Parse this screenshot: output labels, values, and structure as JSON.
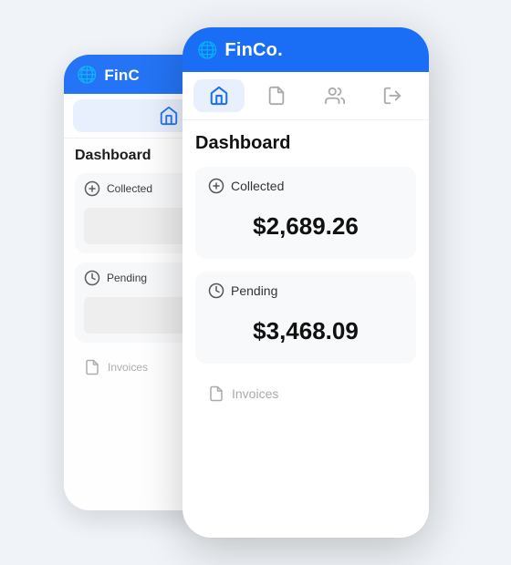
{
  "app": {
    "name": "FinCo.",
    "logo_icon": "🌐"
  },
  "header": {
    "background_color": "#1a6ef5"
  },
  "nav": {
    "tabs": [
      {
        "id": "home",
        "label": "Home",
        "active": true
      },
      {
        "id": "documents",
        "label": "Documents",
        "active": false
      },
      {
        "id": "users",
        "label": "Users",
        "active": false
      },
      {
        "id": "logout",
        "label": "Logout",
        "active": false
      }
    ]
  },
  "dashboard": {
    "title": "Dashboard",
    "collected": {
      "label": "Collected",
      "value": "$2,689.26"
    },
    "pending": {
      "label": "Pending",
      "value": "$3,468.09"
    },
    "invoices": {
      "label": "Invoices"
    }
  }
}
